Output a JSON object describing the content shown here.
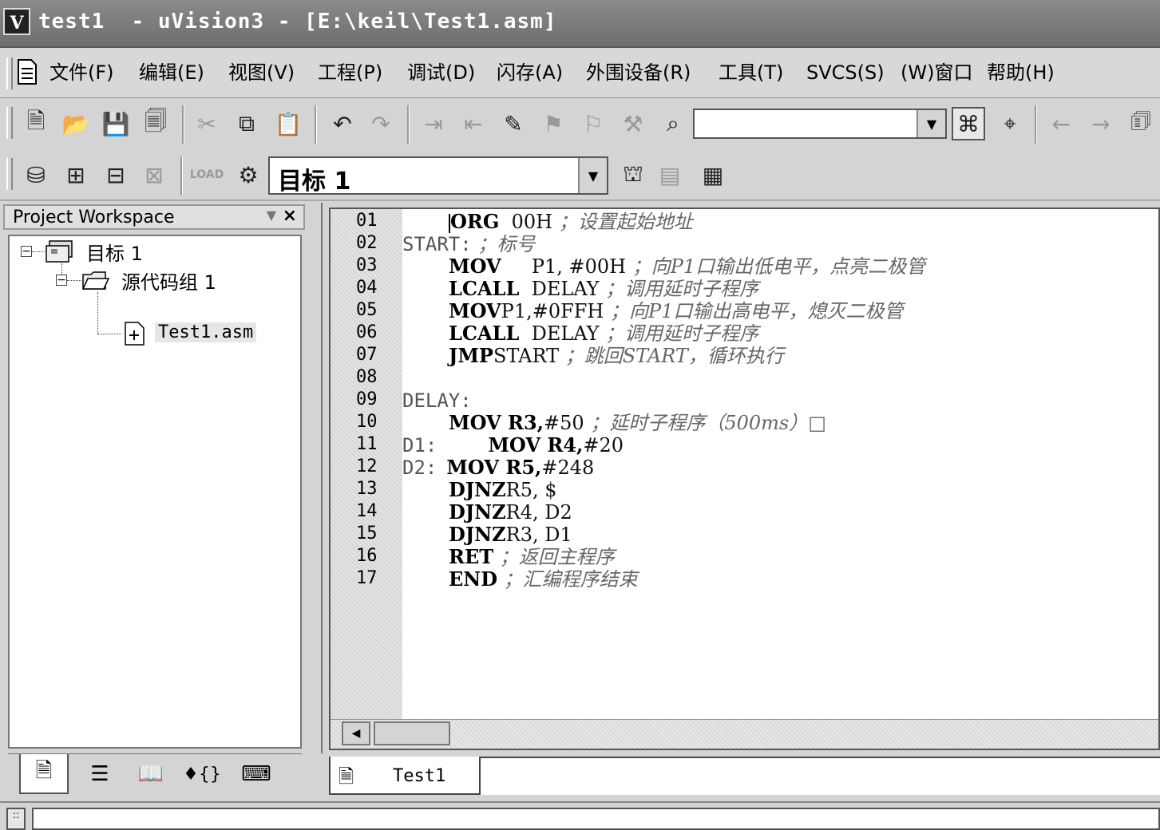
{
  "window": {
    "title": "test1  - uVision3 - [E:\\keil\\Test1.asm]"
  },
  "menu": {
    "items": [
      "文件(F)",
      "编辑(E)",
      "视图(V)",
      "工程(P)",
      "调试(D)",
      "闪存(A)",
      "外围设备(R)",
      "工具(T)",
      "SVCS(S)",
      "(W)窗口",
      "帮助(H)"
    ]
  },
  "toolbar2": {
    "target": "目标 1"
  },
  "workspace": {
    "title": "Project Workspace",
    "tree": {
      "target": "目标 1",
      "group": "源代码组 1",
      "file": "Test1.asm"
    }
  },
  "editor": {
    "tab_label": "Test1",
    "lines": [
      {
        "num": "01",
        "label": "",
        "op": "ORG",
        "args": "  00H",
        "comment": "；设置起始地址"
      },
      {
        "num": "02",
        "label": "START:",
        "op": "",
        "args": "",
        "comment": "；标号"
      },
      {
        "num": "03",
        "label": "",
        "op": "MOV",
        "args": "     P1, #00H",
        "comment": "；向P1口输出低电平，点亮二极管"
      },
      {
        "num": "04",
        "label": "",
        "op": "LCALL",
        "args": "  DELAY",
        "comment": "；调用延时子程序"
      },
      {
        "num": "05",
        "label": "",
        "op": "MOV",
        "args": "P1,#0FFH",
        "comment": "；向P1口输出高电平，熄灭二极管"
      },
      {
        "num": "06",
        "label": "",
        "op": "LCALL",
        "args": "  DELAY",
        "comment": "；调用延时子程序"
      },
      {
        "num": "07",
        "label": "",
        "op": "JMP",
        "args": "START",
        "comment": "；跳回START，循环执行"
      },
      {
        "num": "08",
        "label": "",
        "op": "",
        "args": "",
        "comment": ""
      },
      {
        "num": "09",
        "label": "DELAY:",
        "op": "",
        "args": "",
        "comment": ""
      },
      {
        "num": "10",
        "label": "",
        "op": "MOV R3,",
        "args": "#50",
        "comment": "；延时子程序（500ms）□"
      },
      {
        "num": "11",
        "label": "D1:",
        "op": "MOV R4,",
        "args": "#20",
        "comment": ""
      },
      {
        "num": "12",
        "label": "D2:",
        "op": "MOV R5,",
        "args": "#248",
        "comment": ""
      },
      {
        "num": "13",
        "label": "",
        "op": "DJNZ",
        "args": "R5, $",
        "comment": ""
      },
      {
        "num": "14",
        "label": "",
        "op": "DJNZ",
        "args": "R4, D2",
        "comment": ""
      },
      {
        "num": "15",
        "label": "",
        "op": "DJNZ",
        "args": "R3, D1",
        "comment": ""
      },
      {
        "num": "16",
        "label": "",
        "op": "RET",
        "args": "",
        "comment": "；返回主程序"
      },
      {
        "num": "17",
        "label": "",
        "op": "END",
        "args": "",
        "comment": "；汇编程序结束"
      }
    ]
  },
  "icons": {
    "new": "new-file-icon",
    "open": "open-folder-icon",
    "save": "save-icon",
    "save_all": "save-all-icon",
    "cut": "cut-icon",
    "copy": "copy-icon",
    "paste": "paste-icon",
    "undo": "undo-icon",
    "redo": "redo-icon",
    "find": "find-binoculars-icon",
    "find_in_files": "find-in-files-icon",
    "back": "nav-back-icon",
    "forward": "nav-forward-icon"
  },
  "colors": {
    "titlebar": "#7a7a7a",
    "window_bg": "#d4d4d4",
    "editor_bg": "#ffffff"
  }
}
